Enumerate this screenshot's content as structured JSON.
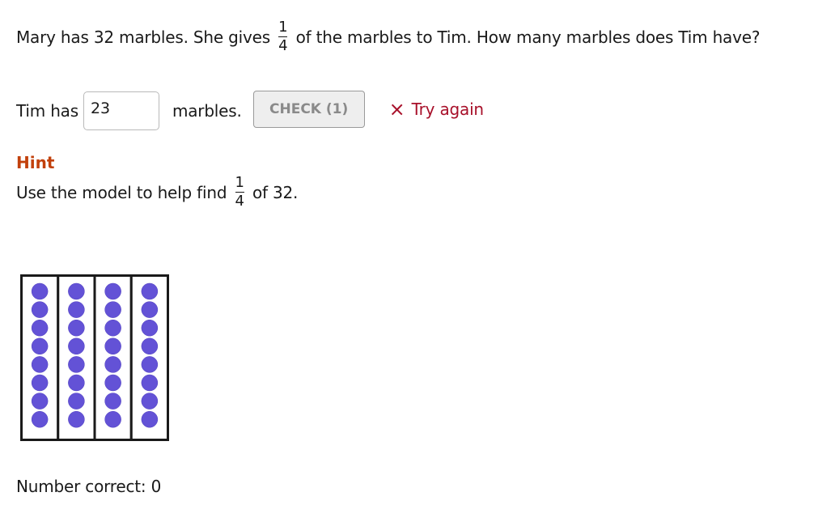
{
  "question": {
    "before_fraction": "Mary has 32 marbles. She gives",
    "fraction": {
      "numerator": "1",
      "denominator": "4"
    },
    "after_fraction": "of the marbles to Tim. How many marbles does Tim have?"
  },
  "answer": {
    "prefix": "Tim has",
    "input_value": "23",
    "suffix": "marbles.",
    "check_label": "CHECK (1)",
    "feedback_icon": "×",
    "feedback_text": "Try again"
  },
  "hint": {
    "title": "Hint",
    "before_fraction": "Use the model to help find",
    "fraction": {
      "numerator": "1",
      "denominator": "4"
    },
    "after_fraction": "of 32."
  },
  "model": {
    "groups": 4,
    "dots_per_group": 8,
    "dot_color": "#6352d6",
    "border_color": "#1a1a1a"
  },
  "status": {
    "number_correct_label": "Number correct:",
    "number_correct_value": "0"
  },
  "colors": {
    "hint_title": "#c2410c",
    "feedback": "#a8102a"
  }
}
